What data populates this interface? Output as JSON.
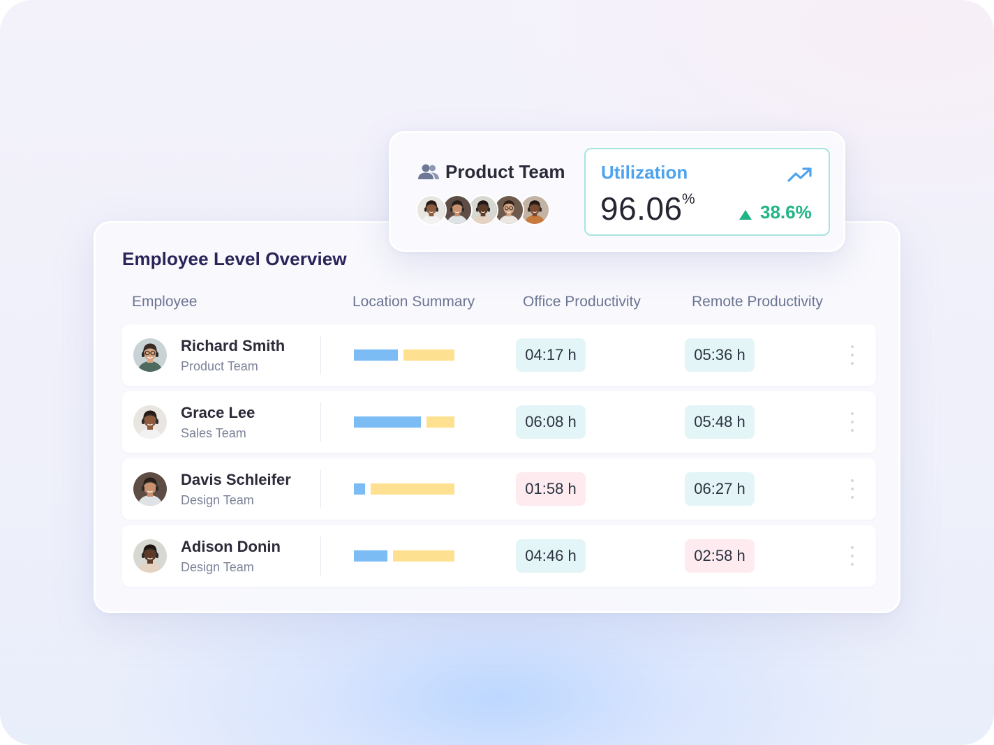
{
  "team_card": {
    "icon": "users-icon",
    "title": "Product Team",
    "member_avatars": [
      "avatar-1",
      "avatar-2",
      "avatar-3",
      "avatar-4",
      "avatar-5"
    ]
  },
  "utilization": {
    "label": "Utilization",
    "value": "96.06",
    "unit": "%",
    "trend_icon": "trending-up-icon",
    "delta_icon": "arrow-up-triangle-icon",
    "delta": "38.6%",
    "colors": {
      "label": "#4fa3ee",
      "delta": "#20b487",
      "border": "#a6e6e0"
    }
  },
  "overview": {
    "title": "Employee Level Overview",
    "columns": {
      "employee": "Employee",
      "location": "Location Summary",
      "office": "Office Productivity",
      "remote": "Remote Productivity"
    },
    "legend_colors": {
      "office": "#7bbcf5",
      "remote": "#fde090"
    },
    "rows": [
      {
        "name": "Richard Smith",
        "team": "Product Team",
        "office_share": 0.44,
        "office": "04:17 h",
        "office_status": "good",
        "remote": "05:36 h",
        "remote_status": "good"
      },
      {
        "name": "Grace Lee",
        "team": "Sales Team",
        "office_share": 0.67,
        "office": "06:08 h",
        "office_status": "good",
        "remote": "05:48 h",
        "remote_status": "good"
      },
      {
        "name": "Davis Schleifer",
        "team": "Design Team",
        "office_share": 0.11,
        "office": "01:58 h",
        "office_status": "bad",
        "remote": "06:27 h",
        "remote_status": "good"
      },
      {
        "name": "Adison Donin",
        "team": "Design Team",
        "office_share": 0.33,
        "office": "04:46 h",
        "office_status": "good",
        "remote": "02:58 h",
        "remote_status": "bad"
      }
    ]
  }
}
